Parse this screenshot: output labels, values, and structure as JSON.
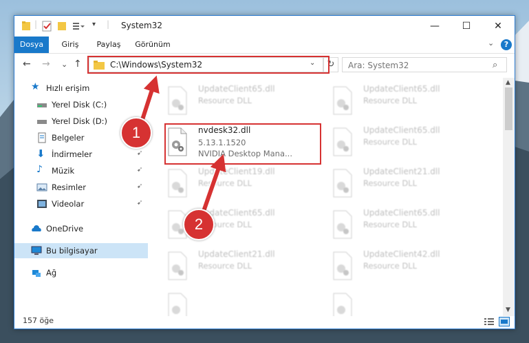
{
  "window": {
    "title": "System32",
    "min_glyph": "—",
    "max_glyph": "☐",
    "close_glyph": "✕"
  },
  "ribbon": {
    "tabs": [
      "Dosya",
      "Giriş",
      "Paylaş",
      "Görünüm"
    ],
    "active_tab": "Dosya",
    "expand_glyph": "⌄",
    "help_glyph": "?"
  },
  "navigation": {
    "back_glyph": "←",
    "forward_glyph": "→",
    "recent_glyph": "⌄",
    "up_glyph": "↑",
    "address": "C:\\Windows\\System32",
    "address_drop_glyph": "⌄",
    "refresh_glyph": "↻",
    "search_placeholder": "Ara: System32"
  },
  "sidebar": {
    "items": [
      {
        "label": "Hızlı erişim",
        "icon": "star-icon",
        "pinned": false
      },
      {
        "label": "Yerel Disk (C:)",
        "icon": "drive-icon",
        "pinned": false
      },
      {
        "label": "Yerel Disk (D:)",
        "icon": "drive-icon",
        "pinned": false
      },
      {
        "label": "Belgeler",
        "icon": "documents-icon",
        "pinned": true
      },
      {
        "label": "İndirmeler",
        "icon": "downloads-icon",
        "pinned": true
      },
      {
        "label": "Müzik",
        "icon": "music-icon",
        "pinned": true
      },
      {
        "label": "Resimler",
        "icon": "pictures-icon",
        "pinned": true
      },
      {
        "label": "Videolar",
        "icon": "videos-icon",
        "pinned": true
      },
      {
        "label": "OneDrive",
        "icon": "cloud-icon",
        "pinned": false
      },
      {
        "label": "Bu bilgisayar",
        "icon": "computer-icon",
        "pinned": false,
        "selected": true
      },
      {
        "label": "Ağ",
        "icon": "network-icon",
        "pinned": false
      }
    ],
    "pin_glyph": "📌"
  },
  "files": [
    {
      "name": "UpdateClient65.dll",
      "type": "Resource DLL",
      "blurred": true
    },
    {
      "name": "UpdateClient65.dll",
      "type": "Resource DLL",
      "blurred": true
    },
    {
      "name": "nvdesk32.dll",
      "version": "5.13.1.1520",
      "description": "NVIDIA Desktop Mana...",
      "blurred": false
    },
    {
      "name": "UpdateClient65.dll",
      "type": "Resource DLL",
      "blurred": true
    },
    {
      "name": "UpdateClient19.dll",
      "type": "Resource DLL",
      "blurred": true
    },
    {
      "name": "UpdateClient21.dll",
      "type": "Resource DLL",
      "blurred": true
    },
    {
      "name": "UpdateClient65.dll",
      "type": "Resource DLL",
      "blurred": true
    },
    {
      "name": "UpdateClient65.dll",
      "type": "Resource DLL",
      "blurred": true
    },
    {
      "name": "UpdateClient21.dll",
      "type": "Resource DLL",
      "blurred": true
    },
    {
      "name": "UpdateClient42.dll",
      "type": "Resource DLL",
      "blurred": true
    }
  ],
  "status": {
    "item_count": "157 öğe"
  },
  "callouts": [
    "1",
    "2"
  ],
  "colors": {
    "accent": "#1979ca",
    "highlight": "#d63232",
    "selected": "#cce4f7"
  }
}
